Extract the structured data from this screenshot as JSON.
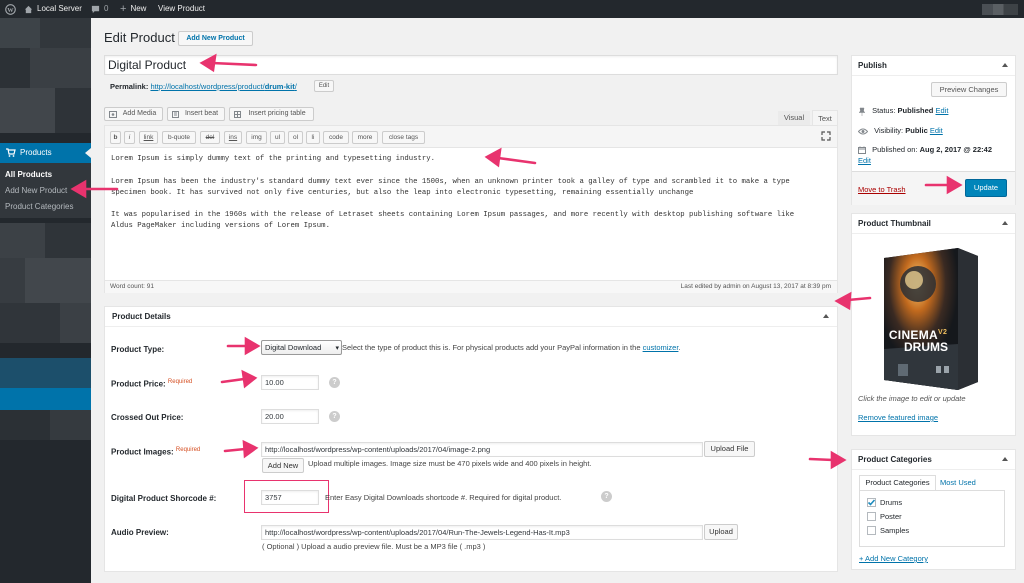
{
  "admin_bar": {
    "site_name": "Local Server",
    "comments_count": "0",
    "new_label": "New",
    "view_label": "View Product"
  },
  "sidebar": {
    "products_label": "Products",
    "submenu": [
      "All Products",
      "Add New Product",
      "Product Categories"
    ],
    "accent_color": "#0073aa"
  },
  "header": {
    "title": "Edit Product",
    "add_new_button": "Add New Product"
  },
  "post": {
    "title": "Digital Product",
    "permalink_label": "Permalink:",
    "permalink_base": "http://localhost/wordpress/product/",
    "permalink_slug": "drum-kit",
    "permalink_end": "/",
    "edit_button": "Edit"
  },
  "media_buttons": [
    "Add Media",
    "Insert beat",
    "Insert pricing table"
  ],
  "editor_tabs": {
    "visual": "Visual",
    "text": "Text"
  },
  "quicktags": [
    "b",
    "i",
    "link",
    "b-quote",
    "del",
    "ins",
    "img",
    "ul",
    "ol",
    "li",
    "code",
    "more",
    "close tags"
  ],
  "editor_content": {
    "p1": "Lorem Ipsum is simply dummy text of the printing and typesetting industry.",
    "p2a": "Lorem Ipsum has been the industry's standard dummy text ever since the 1500s, when an unknown printer took a galley of type and scrambled it to make a type",
    "p2b": "specimen book. It has survived not only five centuries, but also the leap into electronic typesetting, remaining essentially unchange",
    "p3a": "It was popularised in the 1960s with the release of Letraset sheets containing Lorem Ipsum passages, and more recently with desktop publishing software like",
    "p3b": "Aldus PageMaker including versions of Lorem Ipsum."
  },
  "editor_footer": {
    "word_count": "Word count: 91",
    "last_edited": "Last edited by admin on August 13, 2017 at 8:39 pm"
  },
  "product_details": {
    "heading": "Product Details",
    "required_label": "Required",
    "type_label": "Product Type:",
    "type_value": "Digital Download",
    "type_help_before": "Select the type of product this is. For physical products add your PayPal information in the",
    "type_help_link": "customizer",
    "type_help_after": ".",
    "price_label": "Product Price:",
    "price_value": "10.00",
    "crossed_label": "Crossed Out Price:",
    "crossed_value": "20.00",
    "images_label": "Product Images:",
    "images_value": "http://localhost/wordpress/wp-content/uploads/2017/04/image-2.png",
    "upload_file_button": "Upload File",
    "add_new_button": "Add New",
    "images_help": "Upload multiple images. Image size must be 470 pixels wide and 400 pixels in height.",
    "shortcode_label": "Digital Product Shorcode #:",
    "shortcode_value": "3757",
    "shortcode_help": "Enter Easy Digital Downloads shortcode #. Required for digital product.",
    "audio_label": "Audio Preview:",
    "audio_value": "http://localhost/wordpress/wp-content/uploads/2017/04/Run-The-Jewels-Legend-Has-It.mp3",
    "upload_button": "Upload",
    "audio_help": "( Optional ) Upload a audio preview file. Must be a MP3 file ( .mp3 )",
    "help_glyph": "?"
  },
  "publish": {
    "heading": "Publish",
    "preview_button": "Preview Changes",
    "status_label": "Status:",
    "status_value": "Published",
    "visibility_label": "Visibility:",
    "visibility_value": "Public",
    "published_label": "Published on:",
    "published_value": "Aug 2, 2017 @ 22:42",
    "edit_link": "Edit",
    "trash_link": "Move to Trash",
    "update_button": "Update"
  },
  "thumbnail": {
    "heading": "Product Thumbnail",
    "product_name_line1": "CINEMA",
    "product_badge": "V2",
    "product_name_line2": "DRUMS",
    "hint": "Click the image to edit or update",
    "remove_link": "Remove featured image"
  },
  "categories": {
    "heading": "Product Categories",
    "tab_all": "Product Categories",
    "tab_most_used": "Most Used",
    "items": [
      {
        "label": "Drums",
        "checked": true
      },
      {
        "label": "Poster",
        "checked": false
      },
      {
        "label": "Samples",
        "checked": false
      }
    ],
    "add_link": "+ Add New Category"
  },
  "colors": {
    "arrow": "#e8336e",
    "primary_button": "#0085ba",
    "admin_bar": "#23282d",
    "required": "#d54e21"
  }
}
